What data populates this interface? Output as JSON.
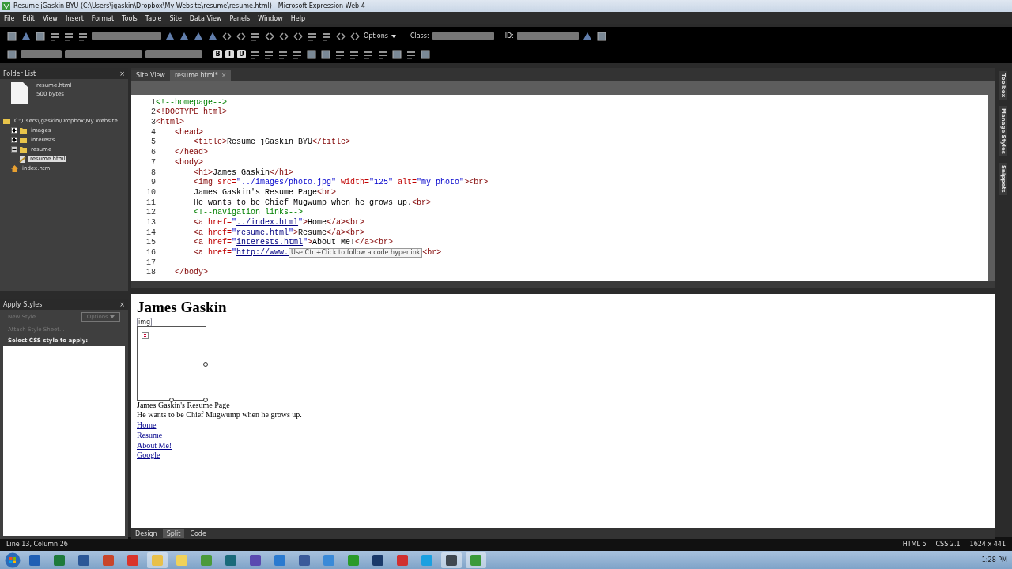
{
  "window": {
    "title": "Resume jGaskin BYU (C:\\Users\\jgaskin\\Dropbox\\My Website\\resume\\resume.html) - Microsoft Expression Web 4"
  },
  "menu": [
    "File",
    "Edit",
    "View",
    "Insert",
    "Format",
    "Tools",
    "Table",
    "Site",
    "Data View",
    "Panels",
    "Window",
    "Help"
  ],
  "toolbar": {
    "options_label": "Options",
    "class_label": "Class:",
    "id_label": "ID:",
    "format_buttons": [
      "B",
      "I",
      "U"
    ]
  },
  "folder_list": {
    "title": "Folder List",
    "file_name": "resume.html",
    "file_size": "500 bytes",
    "tree": [
      {
        "label": "C:\\Users\\jgaskin\\Dropbox\\My Website",
        "kind": "root",
        "selected": false,
        "children": [
          {
            "label": "images",
            "kind": "folder",
            "expanded": false,
            "selected": false
          },
          {
            "label": "interests",
            "kind": "folder",
            "expanded": false,
            "selected": false
          },
          {
            "label": "resume",
            "kind": "folder",
            "expanded": true,
            "selected": false,
            "children": [
              {
                "label": "resume.html",
                "kind": "page",
                "selected": true
              }
            ]
          },
          {
            "label": "index.html",
            "kind": "home",
            "selected": false
          }
        ]
      }
    ]
  },
  "apply_styles": {
    "title": "Apply Styles",
    "new_style": "New Style...",
    "options": "Options",
    "attach": "Attach Style Sheet...",
    "prompt": "Select CSS style to apply:"
  },
  "doc_tabs": [
    {
      "label": "Site View",
      "selected": false,
      "closable": false
    },
    {
      "label": "resume.html*",
      "selected": true,
      "closable": true
    }
  ],
  "close_glyph": "×",
  "code": {
    "lines": [
      {
        "number": "1",
        "tokens": [
          {
            "kind": "comment",
            "text": "<!--homepage-->"
          }
        ]
      },
      {
        "number": "2",
        "tokens": [
          {
            "kind": "tag",
            "text": "<!DOCTYPE html>"
          }
        ]
      },
      {
        "number": "3",
        "tokens": [
          {
            "kind": "tag",
            "text": "<html>"
          }
        ]
      },
      {
        "number": "4",
        "tokens": [
          {
            "kind": "tag",
            "text": "    <head>"
          }
        ]
      },
      {
        "number": "5",
        "tokens": [
          {
            "kind": "tag",
            "text": "        <title>"
          },
          {
            "kind": "text",
            "text": "Resume jGaskin BYU"
          },
          {
            "kind": "tag",
            "text": "</title>"
          }
        ]
      },
      {
        "number": "6",
        "tokens": [
          {
            "kind": "tag",
            "text": "    </head>"
          }
        ]
      },
      {
        "number": "7",
        "tokens": [
          {
            "kind": "tag",
            "text": "    <body>"
          }
        ]
      },
      {
        "number": "8",
        "tokens": [
          {
            "kind": "tag",
            "text": "        <h1>"
          },
          {
            "kind": "text",
            "text": "James Gaskin"
          },
          {
            "kind": "tag",
            "text": "</h1>"
          }
        ]
      },
      {
        "number": "9",
        "tokens": [
          {
            "kind": "tag",
            "text": "        <img"
          },
          {
            "kind": "attr",
            "text": " src="
          },
          {
            "kind": "value",
            "text": "\"../images/photo.jpg\""
          },
          {
            "kind": "attr",
            "text": " width="
          },
          {
            "kind": "value",
            "text": "\"125\""
          },
          {
            "kind": "attr",
            "text": " alt="
          },
          {
            "kind": "value",
            "text": "\"my photo\""
          },
          {
            "kind": "tag",
            "text": "><br>"
          }
        ]
      },
      {
        "number": "10",
        "tokens": [
          {
            "kind": "text",
            "text": "        James Gaskin's Resume Page"
          },
          {
            "kind": "tag",
            "text": "<br>"
          }
        ]
      },
      {
        "number": "11",
        "tokens": [
          {
            "kind": "text",
            "text": "        He wants to be Chief Mugwump when he grows up."
          },
          {
            "kind": "tag",
            "text": "<br>"
          }
        ]
      },
      {
        "number": "12",
        "tokens": [
          {
            "kind": "comment",
            "text": "        <!--navigation links-->"
          }
        ]
      },
      {
        "number": "13",
        "tokens": [
          {
            "kind": "tag",
            "text": "        <a"
          },
          {
            "kind": "attr",
            "text": " href="
          },
          {
            "kind": "value",
            "text": "\""
          },
          {
            "kind": "link",
            "text": "../index.html"
          },
          {
            "kind": "value",
            "text": "\""
          },
          {
            "kind": "tag",
            "text": ">"
          },
          {
            "kind": "text",
            "text": "Home"
          },
          {
            "kind": "tag",
            "text": "</a><br>"
          }
        ]
      },
      {
        "number": "14",
        "tokens": [
          {
            "kind": "tag",
            "text": "        <a"
          },
          {
            "kind": "attr",
            "text": " href="
          },
          {
            "kind": "value",
            "text": "\""
          },
          {
            "kind": "link",
            "text": "resume.html"
          },
          {
            "kind": "value",
            "text": "\""
          },
          {
            "kind": "tag",
            "text": ">"
          },
          {
            "kind": "text",
            "text": "Resume"
          },
          {
            "kind": "tag",
            "text": "</a><br>"
          }
        ]
      },
      {
        "number": "15",
        "tokens": [
          {
            "kind": "tag",
            "text": "        <a"
          },
          {
            "kind": "attr",
            "text": " href="
          },
          {
            "kind": "value",
            "text": "\""
          },
          {
            "kind": "link",
            "text": "interests.html"
          },
          {
            "kind": "value",
            "text": "\""
          },
          {
            "kind": "tag",
            "text": ">"
          },
          {
            "kind": "text",
            "text": "About Me!"
          },
          {
            "kind": "tag",
            "text": "</a><br>"
          }
        ]
      },
      {
        "number": "16",
        "tokens": [
          {
            "kind": "tag",
            "text": "        <a"
          },
          {
            "kind": "attr",
            "text": " href="
          },
          {
            "kind": "value",
            "text": "\""
          },
          {
            "kind": "link",
            "text": "http://www."
          },
          {
            "kind": "tooltip",
            "text": "Use Ctrl+Click to follow a code hyperlink"
          },
          {
            "kind": "tag",
            "text": "<br>"
          }
        ]
      },
      {
        "number": "17"
      },
      {
        "number": "18",
        "tokens": [
          {
            "kind": "tag",
            "text": "    </body>"
          }
        ]
      }
    ]
  },
  "design": {
    "heading": "James Gaskin",
    "img_tag": "img",
    "paragraphs": [
      "James Gaskin's Resume Page",
      "He wants to be Chief Mugwump when he grows up."
    ],
    "links": [
      "Home",
      "Resume",
      "About Me!",
      "Google"
    ]
  },
  "view_tabs": [
    {
      "label": "Design",
      "selected": false
    },
    {
      "label": "Split",
      "selected": true
    },
    {
      "label": "Code",
      "selected": false
    }
  ],
  "side_tabs": [
    "Toolbox",
    "Manage Styles",
    "Snippets"
  ],
  "status_bar": {
    "position": "Line 13, Column 26",
    "doctype": "HTML 5",
    "css": "CSS 2.1",
    "size": "1624 x 441"
  },
  "taskbar": {
    "time": "1:28 PM",
    "apps": [
      {
        "color": "#1f5fb4",
        "selected": false
      },
      {
        "color": "#1e7a3c",
        "selected": false
      },
      {
        "color": "#2b5797",
        "selected": false
      },
      {
        "color": "#c8452a",
        "selected": false
      },
      {
        "color": "#d9342b",
        "selected": false
      },
      {
        "color": "#e8c04a",
        "selected": true
      },
      {
        "color": "#f0d25a",
        "selected": false
      },
      {
        "color": "#4a9a3a",
        "selected": false
      },
      {
        "color": "#1a6a7a",
        "selected": false
      },
      {
        "color": "#5a4ab0",
        "selected": false
      },
      {
        "color": "#2a7ad0",
        "selected": false
      },
      {
        "color": "#3a5a9a",
        "selected": false
      },
      {
        "color": "#3a8ad8",
        "selected": false
      },
      {
        "color": "#2a9a2a",
        "selected": false
      },
      {
        "color": "#1a3a6a",
        "selected": false
      },
      {
        "color": "#d03030",
        "selected": false
      },
      {
        "color": "#1aa0e0",
        "selected": false
      },
      {
        "color": "#404850",
        "selected": true
      },
      {
        "color": "#3a9a3a",
        "selected": true
      }
    ]
  }
}
